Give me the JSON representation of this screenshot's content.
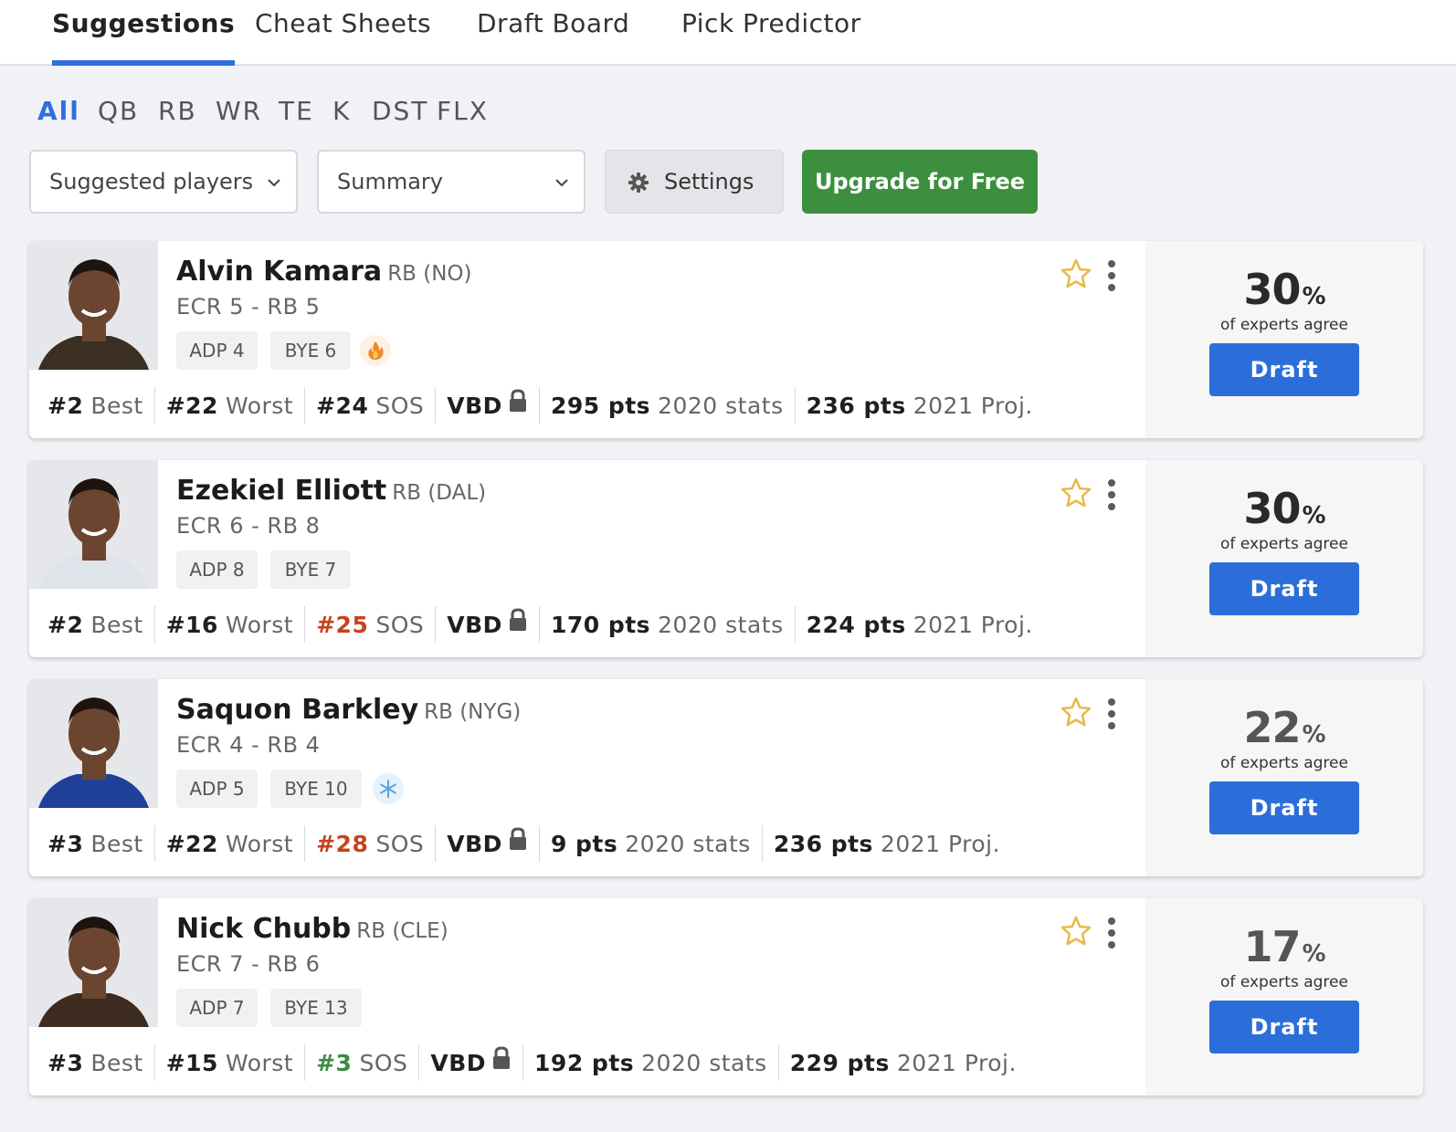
{
  "top_tabs": [
    {
      "label": "Suggestions",
      "active": true
    },
    {
      "label": "Cheat Sheets",
      "active": false
    },
    {
      "label": "Draft Board",
      "active": false
    },
    {
      "label": "Pick Predictor",
      "active": false
    }
  ],
  "position_filters": [
    {
      "label": "All",
      "active": true
    },
    {
      "label": "QB",
      "active": false
    },
    {
      "label": "RB",
      "active": false
    },
    {
      "label": "WR",
      "active": false
    },
    {
      "label": "TE",
      "active": false
    },
    {
      "label": "K",
      "active": false
    },
    {
      "label": "DST",
      "active": false
    },
    {
      "label": "FLX",
      "active": false
    }
  ],
  "controls": {
    "player_select": "Suggested players",
    "view_select": "Summary",
    "settings_label": "Settings",
    "upgrade_label": "Upgrade for Free"
  },
  "colors": {
    "accent_blue": "#2e6fdb",
    "upgrade_green": "#3c8f3f",
    "sos_bad": "#c8421c",
    "sos_good": "#3d8b40",
    "star": "#e8b84a"
  },
  "players": [
    {
      "name": "Alvin Kamara",
      "pos_team": "RB (NO)",
      "ecr": "ECR 5 - RB 5",
      "adp": "ADP 4",
      "bye": "BYE 6",
      "badge": "fire-icon",
      "best_rank": "#2",
      "best_label": "Best",
      "worst_rank": "#22",
      "worst_label": "Worst",
      "sos_rank": "#24",
      "sos_label": "SOS",
      "sos_tone": "neutral",
      "vbd_label": "VBD",
      "pts_2020": "295 pts",
      "pts_2020_label": "2020 stats",
      "pts_2021": "236 pts",
      "pts_2021_label": "2021 Proj.",
      "agree_pct": "30",
      "agree_sym": "%",
      "agree_label": "of experts agree",
      "draft_label": "Draft"
    },
    {
      "name": "Ezekiel Elliott",
      "pos_team": "RB (DAL)",
      "ecr": "ECR 6 - RB 8",
      "adp": "ADP 8",
      "bye": "BYE 7",
      "badge": "",
      "best_rank": "#2",
      "best_label": "Best",
      "worst_rank": "#16",
      "worst_label": "Worst",
      "sos_rank": "#25",
      "sos_label": "SOS",
      "sos_tone": "bad",
      "vbd_label": "VBD",
      "pts_2020": "170 pts",
      "pts_2020_label": "2020 stats",
      "pts_2021": "224 pts",
      "pts_2021_label": "2021 Proj.",
      "agree_pct": "30",
      "agree_sym": "%",
      "agree_label": "of experts agree",
      "draft_label": "Draft"
    },
    {
      "name": "Saquon Barkley",
      "pos_team": "RB (NYG)",
      "ecr": "ECR 4 - RB 4",
      "adp": "ADP 5",
      "bye": "BYE 10",
      "badge": "snowflake-icon",
      "best_rank": "#3",
      "best_label": "Best",
      "worst_rank": "#22",
      "worst_label": "Worst",
      "sos_rank": "#28",
      "sos_label": "SOS",
      "sos_tone": "bad",
      "vbd_label": "VBD",
      "pts_2020": "9 pts",
      "pts_2020_label": "2020 stats",
      "pts_2021": "236 pts",
      "pts_2021_label": "2021 Proj.",
      "agree_pct": "22",
      "agree_sym": "%",
      "agree_label": "of experts agree",
      "draft_label": "Draft"
    },
    {
      "name": "Nick Chubb",
      "pos_team": "RB (CLE)",
      "ecr": "ECR 7 - RB 6",
      "adp": "ADP 7",
      "bye": "BYE 13",
      "badge": "",
      "best_rank": "#3",
      "best_label": "Best",
      "worst_rank": "#15",
      "worst_label": "Worst",
      "sos_rank": "#3",
      "sos_label": "SOS",
      "sos_tone": "good",
      "vbd_label": "VBD",
      "pts_2020": "192 pts",
      "pts_2020_label": "2020 stats",
      "pts_2021": "229 pts",
      "pts_2021_label": "2021 Proj.",
      "agree_pct": "17",
      "agree_sym": "%",
      "agree_label": "of experts agree",
      "draft_label": "Draft"
    }
  ]
}
